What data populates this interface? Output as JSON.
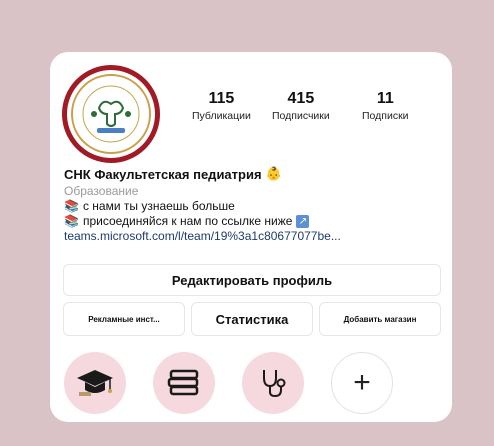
{
  "profile": {
    "avatar_icon": "uterus-emblem-logo",
    "stats": [
      {
        "value": "115",
        "label": "Публикации"
      },
      {
        "value": "415",
        "label": "Подписчики"
      },
      {
        "value": "11",
        "label": "Подписки"
      }
    ],
    "name": "СНК Факультетская педиатрия",
    "name_emoji": "👶",
    "category": "Образование",
    "bio_lines": [
      {
        "icon": "books-icon",
        "text": "с нами ты узнаешь больше"
      },
      {
        "icon": "books-icon",
        "text": "присоединяйся к нам по ссылке ниже",
        "trailing_icon": "arrow-icon"
      }
    ],
    "link": "teams.microsoft.com/l/team/19%3a1c80677077be..."
  },
  "buttons": {
    "edit_profile": "Редактировать профиль",
    "ads_tools": "Рекламные инст...",
    "statistics": "Статистика",
    "add_shop": "Добавить магазин"
  },
  "highlights": [
    {
      "icon": "graduation-cap-icon"
    },
    {
      "icon": "books-stack-icon"
    },
    {
      "icon": "stethoscope-icon"
    },
    {
      "icon": "plus-icon",
      "label": "+"
    }
  ],
  "colors": {
    "background": "#d9c3c7",
    "card": "#ffffff",
    "avatar_ring": "#a11b27",
    "highlight_bg": "#f6d9df",
    "link": "#1e3a6e"
  }
}
